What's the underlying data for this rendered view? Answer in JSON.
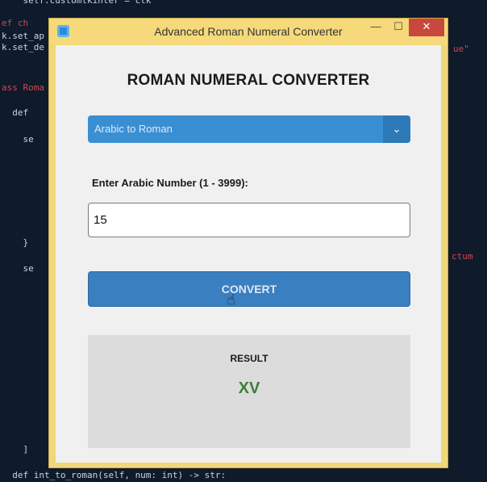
{
  "background_code": [
    {
      "text": "    self.customtkinter = ctk",
      "cls": ""
    },
    {
      "text": "ef ch",
      "cls": "kw"
    },
    {
      "text": "k.set_ap",
      "cls": ""
    },
    {
      "text": "k.set_de",
      "cls": ""
    },
    {
      "text": "ass Roma",
      "cls": "kw"
    },
    {
      "text": "  def",
      "cls": ""
    },
    {
      "text": "    se",
      "cls": ""
    },
    {
      "text": "    }",
      "cls": ""
    },
    {
      "text": "    se",
      "cls": ""
    },
    {
      "text": "    ]",
      "cls": ""
    },
    {
      "text": "  def int_to_roman(self, num: int) -> str:",
      "cls": ""
    }
  ],
  "background_code_right": [
    "ue\"",
    "ctum"
  ],
  "window": {
    "title": "Advanced Roman Numeral Converter",
    "minimize_glyph": "—",
    "maximize_glyph": "☐",
    "close_glyph": "✕"
  },
  "converter": {
    "heading": "ROMAN NUMERAL CONVERTER",
    "mode_selected": "Arabic to Roman",
    "mode_arrow": "⌄",
    "input_label": "Enter Arabic Number (1 - 3999):",
    "input_value": "15",
    "convert_label": "CONVERT",
    "result_label": "RESULT",
    "result_value": "XV"
  },
  "colors": {
    "accent": "#3a8fd3",
    "button": "#3a7fc0",
    "result_text": "#3a7f3a",
    "window_frame": "#f5d97a",
    "close": "#c9483e"
  }
}
